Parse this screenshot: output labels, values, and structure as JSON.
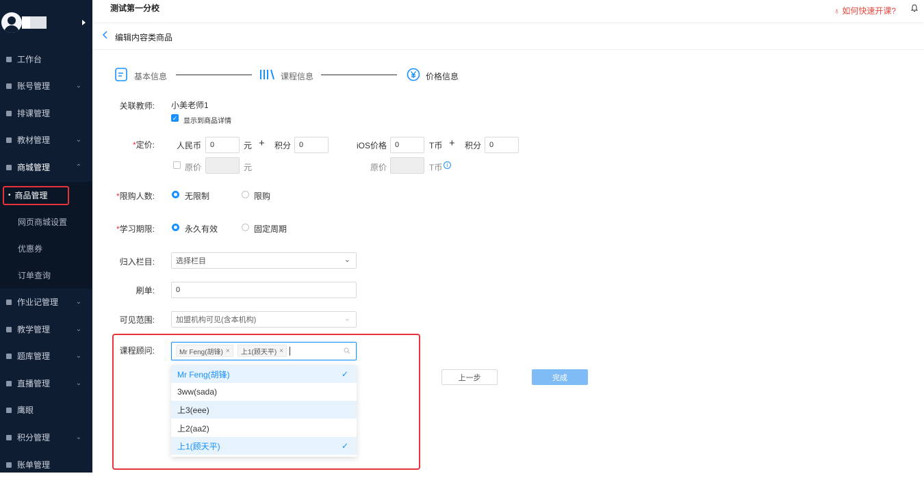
{
  "header": {
    "school": "测试第一分校",
    "help_link": "如何快速开课?",
    "help_icon": "flame-icon",
    "bell_icon": "bell-icon"
  },
  "page": {
    "back_icon": "chevron-left-icon",
    "title": "编辑内容类商品"
  },
  "sidebar": {
    "items": [
      {
        "label": "工作台",
        "icon": "monitor-icon",
        "chevron": false
      },
      {
        "label": "账号管理",
        "icon": "user-icon",
        "chevron": true
      },
      {
        "label": "排课管理",
        "icon": "calendar-icon",
        "chevron": false
      },
      {
        "label": "教材管理",
        "icon": "book-icon",
        "chevron": true
      },
      {
        "label": "商城管理",
        "icon": "store-icon",
        "chevron": true,
        "open": true
      },
      {
        "label": "作业记管理",
        "icon": "pen-icon",
        "chevron": true
      },
      {
        "label": "教学管理",
        "icon": "teach-icon",
        "chevron": true
      },
      {
        "label": "题库管理",
        "icon": "question-bank-icon",
        "chevron": true
      },
      {
        "label": "直播管理",
        "icon": "live-icon",
        "chevron": true
      },
      {
        "label": "鹰眼",
        "icon": "eye-icon",
        "chevron": false
      },
      {
        "label": "积分管理",
        "icon": "points-icon",
        "chevron": true
      },
      {
        "label": "账单管理",
        "icon": "bill-icon",
        "chevron": false
      }
    ],
    "sub_items": [
      {
        "label": "商品管理",
        "active": true
      },
      {
        "label": "网页商城设置"
      },
      {
        "label": "优惠券"
      },
      {
        "label": "订单查询"
      }
    ]
  },
  "steps": [
    {
      "label": "基本信息",
      "icon": "document-icon"
    },
    {
      "label": "课程信息",
      "icon": "books-icon"
    },
    {
      "label": "价格信息",
      "icon": "yuan-icon",
      "active": true
    }
  ],
  "form": {
    "teacher": {
      "label": "关联教师:",
      "value": "小美老师1",
      "show_label": "显示到商品详情",
      "checked": true
    },
    "price": {
      "label": "定价:",
      "rmb_label": "人民币",
      "rmb_value": "0",
      "yuan": "元",
      "plus": "+",
      "points_label": "积分",
      "points_value": "0",
      "ios_label": "iOS价格",
      "ios_value": "0",
      "tcoin": "T币",
      "ios_points_label": "积分",
      "ios_points_value": "0",
      "orig_label": "原价",
      "orig_yuan": "元",
      "ios_orig_label": "原价",
      "ios_orig_tcoin": "T币",
      "info_icon": "info-icon"
    },
    "limit": {
      "label": "限购人数:",
      "opt1": "无限制",
      "opt2": "限购",
      "selected": "无限制"
    },
    "period": {
      "label": "学习期限:",
      "opt1": "永久有效",
      "opt2": "固定周期",
      "selected": "永久有效"
    },
    "column": {
      "label": "归入栏目:",
      "placeholder": "选择栏目"
    },
    "brush": {
      "label": "刷单:",
      "value": "0"
    },
    "visible": {
      "label": "可见范围:",
      "value": "加盟机构可见(含本机构)"
    },
    "advisor": {
      "label": "课程顾问:",
      "tags": [
        "Mr Feng(胡锋)",
        "上1(顾天平)"
      ],
      "search_icon": "search-icon",
      "options": [
        {
          "label": "Mr Feng(胡锋)",
          "selected": true
        },
        {
          "label": "3ww(sada)",
          "selected": false
        },
        {
          "label": "上3(eee)",
          "selected": false,
          "hover": true
        },
        {
          "label": "上2(aa2)",
          "selected": false
        },
        {
          "label": "上1(顾天平)",
          "selected": true
        }
      ]
    }
  },
  "buttons": {
    "prev": "上一步",
    "finish": "完成"
  },
  "colors": {
    "accent": "#1890ff",
    "sidebar": "#0f1d33",
    "highlight": "#e6333a"
  }
}
